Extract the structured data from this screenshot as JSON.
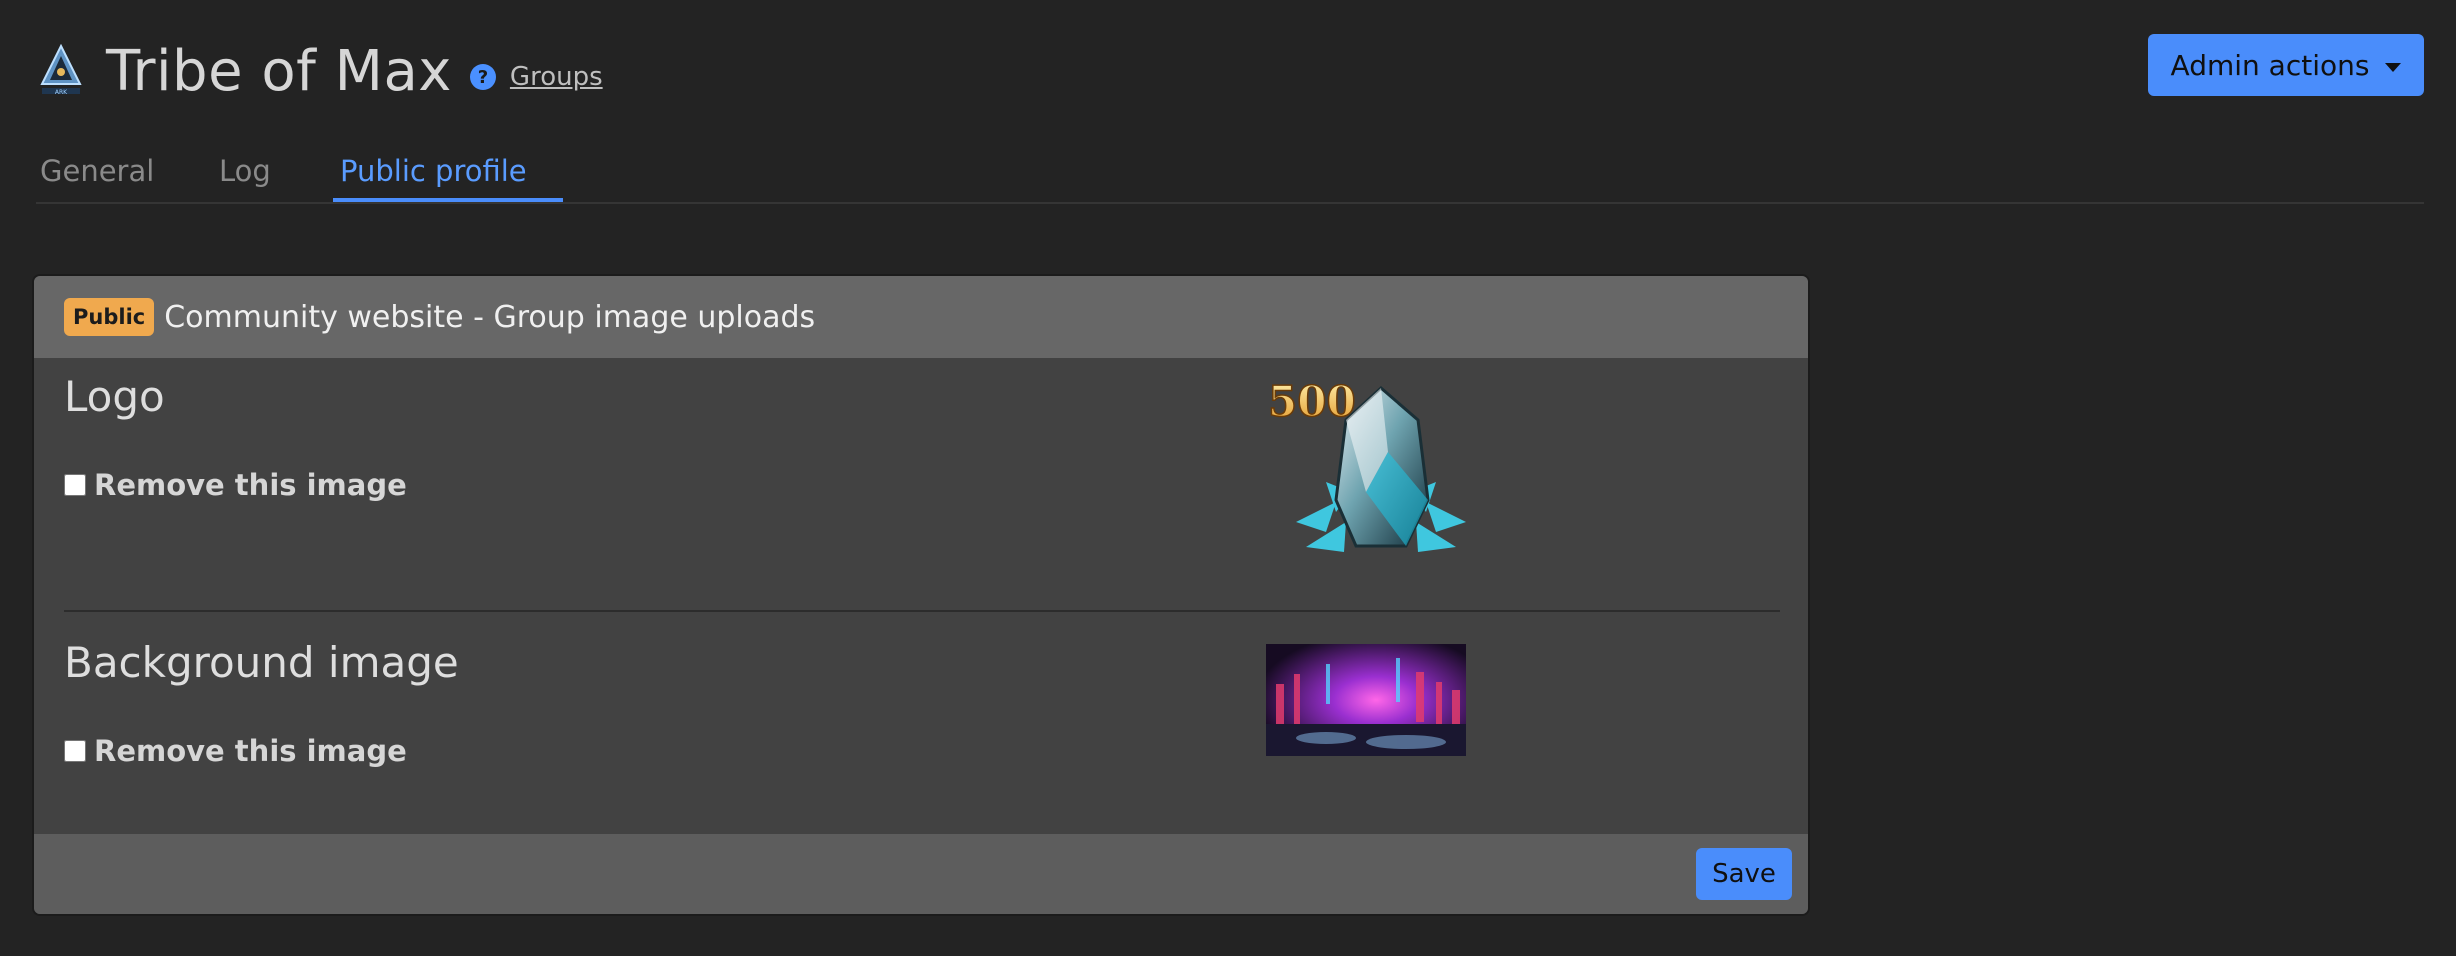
{
  "header": {
    "logo_icon": "ark-tribe-logo",
    "title": "Tribe of Max",
    "help_icon": "question-circle-icon",
    "help_glyph": "?",
    "groups_link": "Groups",
    "admin_button": "Admin actions"
  },
  "tabs": [
    {
      "label": "General",
      "active": false
    },
    {
      "label": "Log",
      "active": false
    },
    {
      "label": "Public profile",
      "active": true
    }
  ],
  "card": {
    "badge": "Public",
    "title": "Community website - Group image uploads",
    "sections": [
      {
        "heading": "Logo",
        "remove_label": "Remove this image",
        "remove_checked": false,
        "image_text": "500"
      },
      {
        "heading": "Background image",
        "remove_label": "Remove this image",
        "remove_checked": false
      }
    ],
    "save_label": "Save"
  },
  "colors": {
    "accent": "#4a8dfb",
    "badge": "#f0a94e",
    "background": "#232323",
    "card": "#424242"
  }
}
